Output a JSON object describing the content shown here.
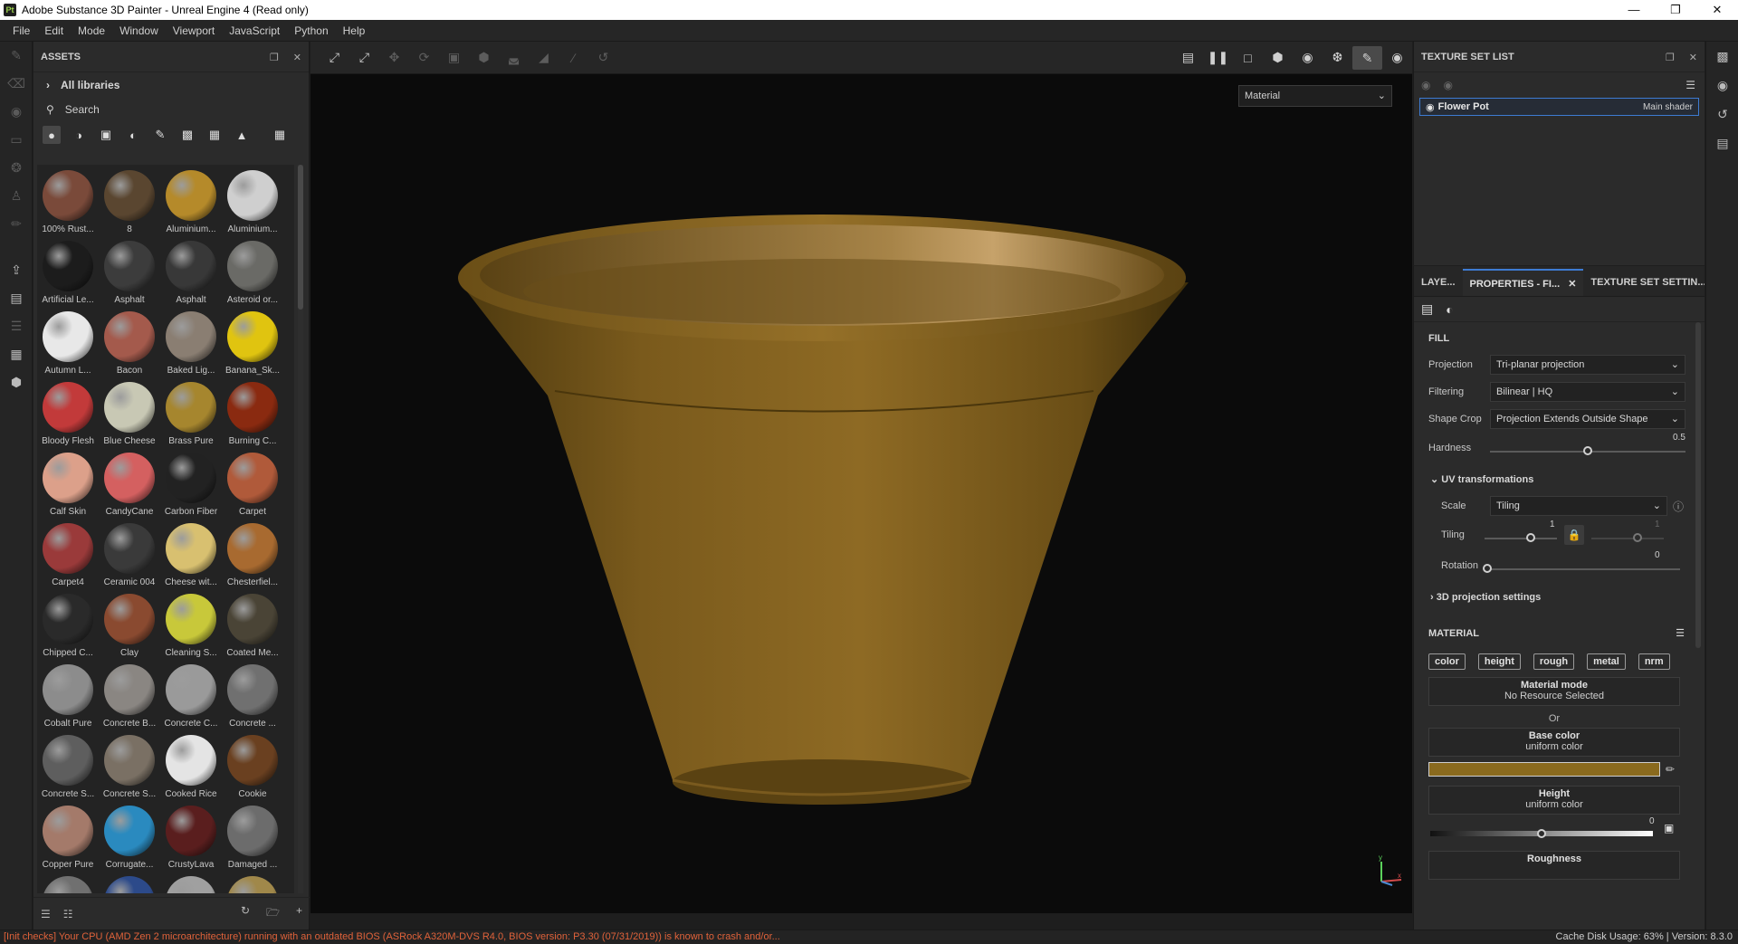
{
  "window": {
    "app_icon": "Pt",
    "title": "Adobe Substance 3D Painter - Unreal Engine 4 (Read only)",
    "controls": [
      "minimize",
      "restore",
      "close"
    ]
  },
  "menu": [
    "File",
    "Edit",
    "Mode",
    "Window",
    "Viewport",
    "JavaScript",
    "Python",
    "Help"
  ],
  "assets": {
    "title": "ASSETS",
    "libraries": "All libraries",
    "search_placeholder": "Search",
    "items": [
      {
        "label": "100% Rust...",
        "color": "#7a4a3a"
      },
      {
        "label": "8",
        "color": "#5a4630"
      },
      {
        "label": "Aluminium...",
        "color": "#b58a2a"
      },
      {
        "label": "Aluminium...",
        "color": "#cfcfcf"
      },
      {
        "label": "Artificial Le...",
        "color": "#1c1c1c"
      },
      {
        "label": "Asphalt",
        "color": "#3c3c3c"
      },
      {
        "label": "Asphalt",
        "color": "#383838"
      },
      {
        "label": "Asteroid or...",
        "color": "#6a6a66"
      },
      {
        "label": "Autumn L...",
        "color": "#e8e8e8"
      },
      {
        "label": "Bacon",
        "color": "#a45a4c"
      },
      {
        "label": "Baked Lig...",
        "color": "#8a7e72"
      },
      {
        "label": "Banana_Sk...",
        "color": "#e0c410"
      },
      {
        "label": "Bloody Flesh",
        "color": "#c23a3a"
      },
      {
        "label": "Blue Cheese",
        "color": "#c8c8b4"
      },
      {
        "label": "Brass Pure",
        "color": "#a6862e"
      },
      {
        "label": "Burning C...",
        "color": "#8a2a10"
      },
      {
        "label": "Calf Skin",
        "color": "#dca08a"
      },
      {
        "label": "CandyCane",
        "color": "#d46060"
      },
      {
        "label": "Carbon Fiber",
        "color": "#222222"
      },
      {
        "label": "Carpet",
        "color": "#b05a3a"
      },
      {
        "label": "Carpet4",
        "color": "#9a3a3a"
      },
      {
        "label": "Ceramic 004",
        "color": "#3a3a3a"
      },
      {
        "label": "Cheese wit...",
        "color": "#d8c070"
      },
      {
        "label": "Chesterfiel...",
        "color": "#a86a30"
      },
      {
        "label": "Chipped C...",
        "color": "#2a2a2a"
      },
      {
        "label": "Clay",
        "color": "#8a4a30"
      },
      {
        "label": "Cleaning S...",
        "color": "#c8c83a"
      },
      {
        "label": "Coated Me...",
        "color": "#4a4436"
      },
      {
        "label": "Cobalt Pure",
        "color": "#8c8c8c"
      },
      {
        "label": "Concrete B...",
        "color": "#8a8682"
      },
      {
        "label": "Concrete C...",
        "color": "#9a9a9a"
      },
      {
        "label": "Concrete ...",
        "color": "#707070"
      },
      {
        "label": "Concrete S...",
        "color": "#5e5e5e"
      },
      {
        "label": "Concrete S...",
        "color": "#7a7064"
      },
      {
        "label": "Cooked Rice",
        "color": "#e4e4e4"
      },
      {
        "label": "Cookie",
        "color": "#6a4020"
      },
      {
        "label": "Copper Pure",
        "color": "#a47a6a"
      },
      {
        "label": "Corrugate...",
        "color": "#2a8abf"
      },
      {
        "label": "CrustyLava",
        "color": "#5a1e1e"
      },
      {
        "label": "Damaged ...",
        "color": "#6c6c6c"
      },
      {
        "label": "",
        "color": "#707070"
      },
      {
        "label": "",
        "color": "#2c4a8a"
      },
      {
        "label": "",
        "color": "#a0a0a0"
      },
      {
        "label": "",
        "color": "#a0884a"
      }
    ]
  },
  "viewport": {
    "material_mode": "Material",
    "object_color": "#7f5f1e"
  },
  "texture_set_list": {
    "title": "TEXTURE SET LIST",
    "item_name": "Flower Pot",
    "item_shader": "Main shader"
  },
  "tabs": [
    "LAYE...",
    "PROPERTIES - FI...",
    "TEXTURE SET SETTIN..."
  ],
  "fill": {
    "title": "FILL",
    "projection_label": "Projection",
    "projection_value": "Tri-planar projection",
    "filtering_label": "Filtering",
    "filtering_value": "Bilinear | HQ",
    "shape_crop_label": "Shape Crop",
    "shape_crop_value": "Projection Extends Outside Shape",
    "hardness_label": "Hardness",
    "hardness_value": "0.5",
    "uv_title": "UV transformations",
    "scale_label": "Scale",
    "scale_value": "Tiling",
    "tiling_label": "Tiling",
    "tiling_value": "1",
    "tiling_value2": "1",
    "rotation_label": "Rotation",
    "rotation_value": "0",
    "proj3d_title": "3D projection settings"
  },
  "material": {
    "title": "MATERIAL",
    "channels": [
      "color",
      "height",
      "rough",
      "metal",
      "nrm"
    ],
    "mode_title": "Material mode",
    "mode_value": "No Resource Selected",
    "or": "Or",
    "base_color_title": "Base color",
    "base_color_sub": "uniform color",
    "base_color_hex": "#8a6a1e",
    "height_title": "Height",
    "height_sub": "uniform color",
    "height_value": "0",
    "roughness_title": "Roughness"
  },
  "status": {
    "message": "[Init checks] Your CPU (AMD Zen 2 microarchitecture) running with an outdated BIOS (ASRock A320M-DVS R4.0, BIOS version: P3.30 (07/31/2019)) is known to crash and/or...",
    "cache": "Cache Disk Usage:   63% | Version: 8.3.0"
  }
}
